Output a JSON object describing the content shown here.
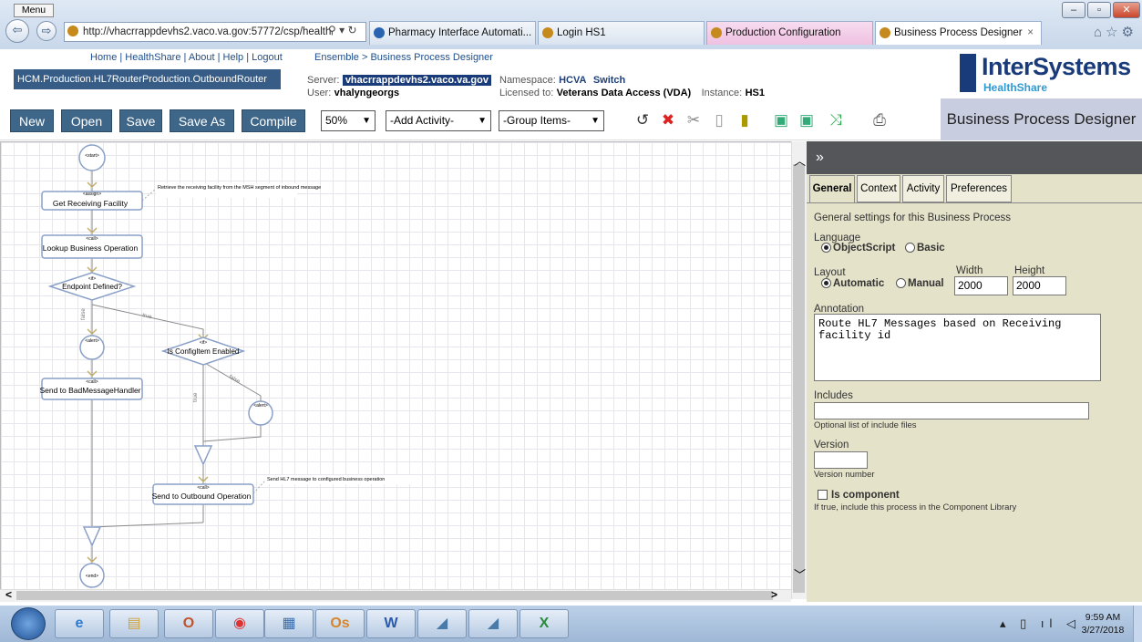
{
  "browser": {
    "address": "http://vhacrrappdevhs2.vaco.va.gov:57772/csp/health",
    "tabs": [
      {
        "label": "Pharmacy Interface Automati..."
      },
      {
        "label": "Login HS1"
      },
      {
        "label": "Production Configuration"
      },
      {
        "label": "Business Process Designer"
      }
    ],
    "close_tab": "×"
  },
  "header": {
    "menu": "Menu",
    "links": "Home | HealthShare | About | Help | Logout",
    "breadcrumb": "Ensemble > Business Process Designer",
    "production": "HCM.Production.HL7RouterProduction.OutboundRouter",
    "server_label": "Server:",
    "server_value": "vhacrrappdevhs2.vaco.va.gov",
    "namespace_label": "Namespace:",
    "namespace_value": "HCVA",
    "switch": "Switch",
    "user_label": "User:",
    "user_value": "vhalyngeorgs",
    "licensed_label": "Licensed to:",
    "licensed_value": "Veterans Data Access (VDA)",
    "instance_label": "Instance:",
    "instance_value": "HS1",
    "logo_main": "InterSystems",
    "logo_sub": "HealthShare"
  },
  "toolbar": {
    "new": "New",
    "open": "Open",
    "save": "Save",
    "save_as": "Save As",
    "compile": "Compile",
    "zoom": "50%",
    "add_activity": "-Add Activity-",
    "group_items": "-Group Items-",
    "title": "Business Process Designer"
  },
  "diagram": {
    "start": "<start>",
    "end": "<end>",
    "assign_tag": "<assign>",
    "call_tag": "<call>",
    "if_tag": "<if>",
    "alert_tag": "<alert>",
    "get_receiving": "Get Receiving Facility",
    "get_receiving_note": "Retrieve the receiving facility from the MSH segment of inbound message",
    "lookup": "Lookup Business Operation",
    "endpoint": "Endpoint Defined?",
    "is_config": "Is ConfigItem Enabled",
    "send_bad": "Send to BadMessageHandler",
    "send_outbound": "Send to Outbound Operation",
    "send_note": "Send HL7 message to configured business operation",
    "true": "true",
    "false": "false"
  },
  "panel": {
    "collapse": "»",
    "tabs": [
      "General",
      "Context",
      "Activity",
      "Preferences"
    ],
    "general_title": "General settings for this Business Process",
    "language_label": "Language",
    "lang_objectscript": "ObjectScript",
    "lang_basic": "Basic",
    "layout_label": "Layout",
    "layout_automatic": "Automatic",
    "layout_manual": "Manual",
    "width_label": "Width",
    "width_value": "2000",
    "height_label": "Height",
    "height_value": "2000",
    "annotation_label": "Annotation",
    "annotation_value": "Route HL7 Messages based on Receiving facility id",
    "includes_label": "Includes",
    "includes_value": "",
    "includes_help": "Optional list of include files",
    "version_label": "Version",
    "version_value": "",
    "version_help": "Version number",
    "component_label": "Is component",
    "component_help": "If true, include this process in the Component Library"
  },
  "taskbar": {
    "time": "9:59 AM",
    "date": "3/27/2018"
  }
}
